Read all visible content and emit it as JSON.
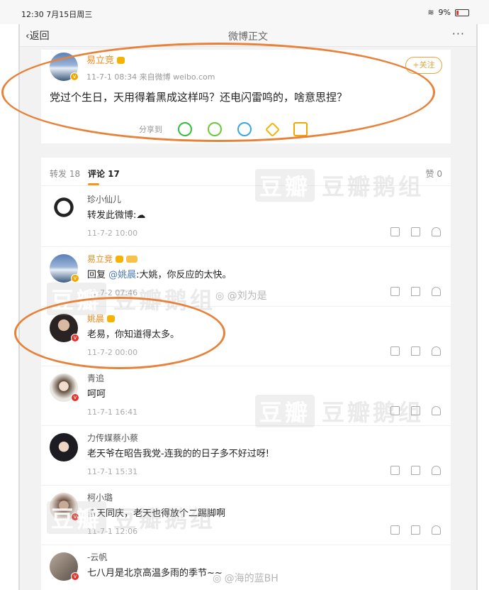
{
  "status_bar": {
    "time": "12:30",
    "date": "7月15日周三",
    "battery": "9%"
  },
  "nav": {
    "back_label": "返回",
    "title": "微博正文",
    "more_label": "···"
  },
  "post": {
    "author": "易立竞",
    "meta": "11-7-1 08:34  来自微博 weibo.com",
    "text": "党过个生日，天用得着黑成这样吗？还电闪雷鸣的，啥意思捏？",
    "follow_label": "+关注",
    "share_label": "分享到",
    "share_targets": [
      "wechat-icon",
      "moments-icon",
      "qq-icon",
      "qzone-icon",
      "more-share-icon"
    ]
  },
  "tabs": {
    "repost": "转发 18",
    "comment": "评论 17",
    "like": "赞 0"
  },
  "comments": [
    {
      "name": "珍小仙儿",
      "text": "转发此微博:",
      "time": "11-7-2 10:00",
      "orange": false
    },
    {
      "name": "易立竞",
      "text_prefix": "回复",
      "mention": "@姚晨",
      "text": ":大姚，你反应的太快。",
      "time": "11-7-2 07:46",
      "orange": true
    },
    {
      "name": "姚晨",
      "text": "老易，你知道得太多。",
      "time": "11-7-2 00:00",
      "orange": true
    },
    {
      "name": "青追",
      "text": "呵呵",
      "time": "11-7-1 16:41",
      "orange": false
    },
    {
      "name": "力传媒蔡小蔡",
      "text": "老天爷在昭告我党-连我的的日子多不好过呀!",
      "time": "11-7-1 15:31",
      "orange": false
    },
    {
      "name": "柯小璐",
      "text": "普天同庆，老天也得放个二踢脚啊",
      "time": "11-7-1 12:06",
      "orange": false
    },
    {
      "name": "-云帆",
      "text": "七八月是北京高温多雨的季节~~",
      "time": "",
      "orange": false
    }
  ],
  "watermarks": {
    "douban_box": "豆瓣",
    "douban_text": "豆瓣鹅组",
    "stamp1": "@刘为是",
    "stamp2": "@海的蓝BH"
  },
  "colors": {
    "annotation": "#e8823a",
    "accent": "#e98a1a",
    "link": "#4a79b0"
  }
}
